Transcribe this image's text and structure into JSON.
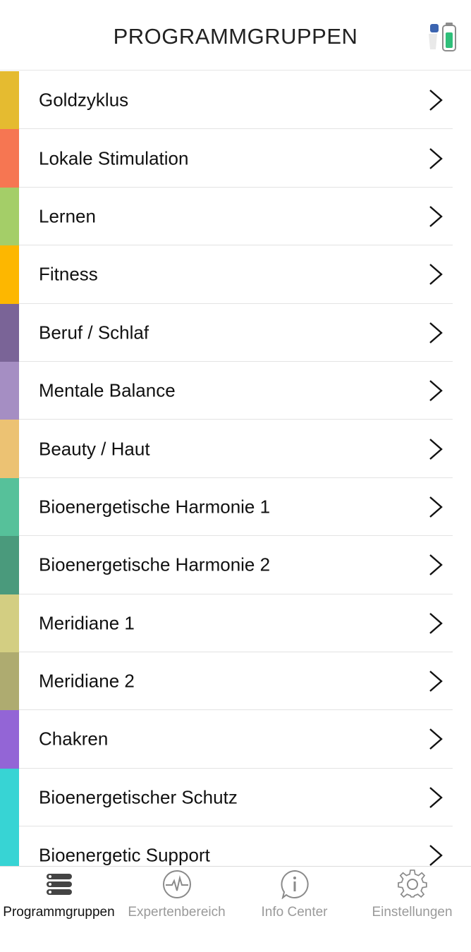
{
  "header": {
    "title": "PROGRAMMGRUPPEN",
    "status_icon": "device-battery-icon"
  },
  "groups": [
    {
      "label": "Goldzyklus",
      "color": "#e5bb30"
    },
    {
      "label": "Lokale Stimulation",
      "color": "#f67652"
    },
    {
      "label": "Lernen",
      "color": "#a4ce68"
    },
    {
      "label": "Fitness",
      "color": "#fdb700"
    },
    {
      "label": "Beruf / Schlaf",
      "color": "#7a6497"
    },
    {
      "label": "Mentale Balance",
      "color": "#a58ec3"
    },
    {
      "label": "Beauty / Haut",
      "color": "#ecc273"
    },
    {
      "label": "Bioenergetische Harmonie 1",
      "color": "#56c19a"
    },
    {
      "label": "Bioenergetische Harmonie 2",
      "color": "#4a9a7c"
    },
    {
      "label": "Meridiane 1",
      "color": "#d3ce82"
    },
    {
      "label": "Meridiane 2",
      "color": "#aeab70"
    },
    {
      "label": "Chakren",
      "color": "#9365d6"
    },
    {
      "label": "Bioenergetischer Schutz",
      "color": "#37d4d4"
    },
    {
      "label": "Bioenergetic Support",
      "color": "#37d4d4"
    }
  ],
  "tabbar": {
    "tabs": [
      {
        "label": "Programmgruppen",
        "icon": "stack-list-icon",
        "active": true
      },
      {
        "label": "Expertenbereich",
        "icon": "pulse-icon",
        "active": false
      },
      {
        "label": "Info Center",
        "icon": "info-bubble-icon",
        "active": false
      },
      {
        "label": "Einstellungen",
        "icon": "gear-icon",
        "active": false
      }
    ],
    "active_color": "#111111",
    "inactive_color": "#9a9a9a"
  }
}
